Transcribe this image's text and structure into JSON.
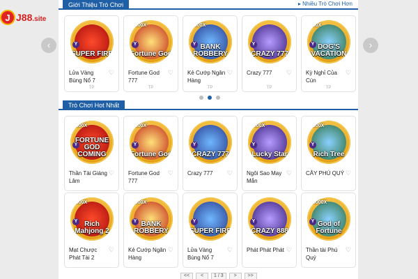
{
  "logo": {
    "badge": "J",
    "text": "J88",
    "suffix": ".site"
  },
  "section1": {
    "title": "Giới Thiệu Trò Chơi",
    "more": "Nhiều Trò Chơi Hơn"
  },
  "section2": {
    "title": "Trò Chơi Hot Nhất"
  },
  "nav": {
    "prev": "‹",
    "next": "›"
  },
  "carousel_pages": 3,
  "carousel_active": 2,
  "intro_games": [
    {
      "name": "Lửa Vàng Bùng Nổ 7",
      "art": "SUPER FIRE",
      "tag": "TP",
      "mult": ""
    },
    {
      "name": "Fortune God 777",
      "art": "Fortune God",
      "tag": "TP",
      "mult": "1000X"
    },
    {
      "name": "Kẻ Cướp Ngân Hàng",
      "art": "BANK ROBBERY",
      "tag": "TP",
      "mult": "5000X"
    },
    {
      "name": "Crazy 777",
      "art": "CRAZY 777",
      "tag": "TP",
      "mult": ""
    },
    {
      "name": "Kỳ Nghỉ Của Cún",
      "art": "DOG'S VACATION",
      "tag": "TP",
      "mult": "500X"
    }
  ],
  "hot_games": [
    {
      "name": "Thần Tài Giáng Lâm",
      "art": "FORTUNE GOD COMING",
      "mult": "5000X"
    },
    {
      "name": "Fortune God 777",
      "art": "Fortune God",
      "mult": "1000X"
    },
    {
      "name": "Crazy 777",
      "art": "CRAZY 777",
      "mult": ""
    },
    {
      "name": "Ngôi Sao May Mắn",
      "art": "Lucky Star",
      "mult": "9000X"
    },
    {
      "name": "CÂY PHÚ QUÝ",
      "art": "Rich Tree",
      "mult": "2000X"
    },
    {
      "name": "Mạt Chược Phát Tài 2",
      "art": "Rich Mahjong 2",
      "mult": "5000X"
    },
    {
      "name": "Kẻ Cướp Ngân Hàng",
      "art": "BANK ROBBERY",
      "mult": "5000X"
    },
    {
      "name": "Lửa Vàng Bùng Nổ 7",
      "art": "SUPER FIRE",
      "mult": ""
    },
    {
      "name": "Phát Phát Phát",
      "art": "CRAZY 888",
      "mult": ""
    },
    {
      "name": "Thần tài Phú Quý",
      "art": "God of Fortune",
      "mult": "50000X"
    }
  ],
  "pager": {
    "first": "<<",
    "prev": "<",
    "current": "1 / 3",
    "next": ">",
    "last": ">>"
  },
  "colors": {
    "accent": "#1f5fa6",
    "gold": "#e8a419"
  }
}
